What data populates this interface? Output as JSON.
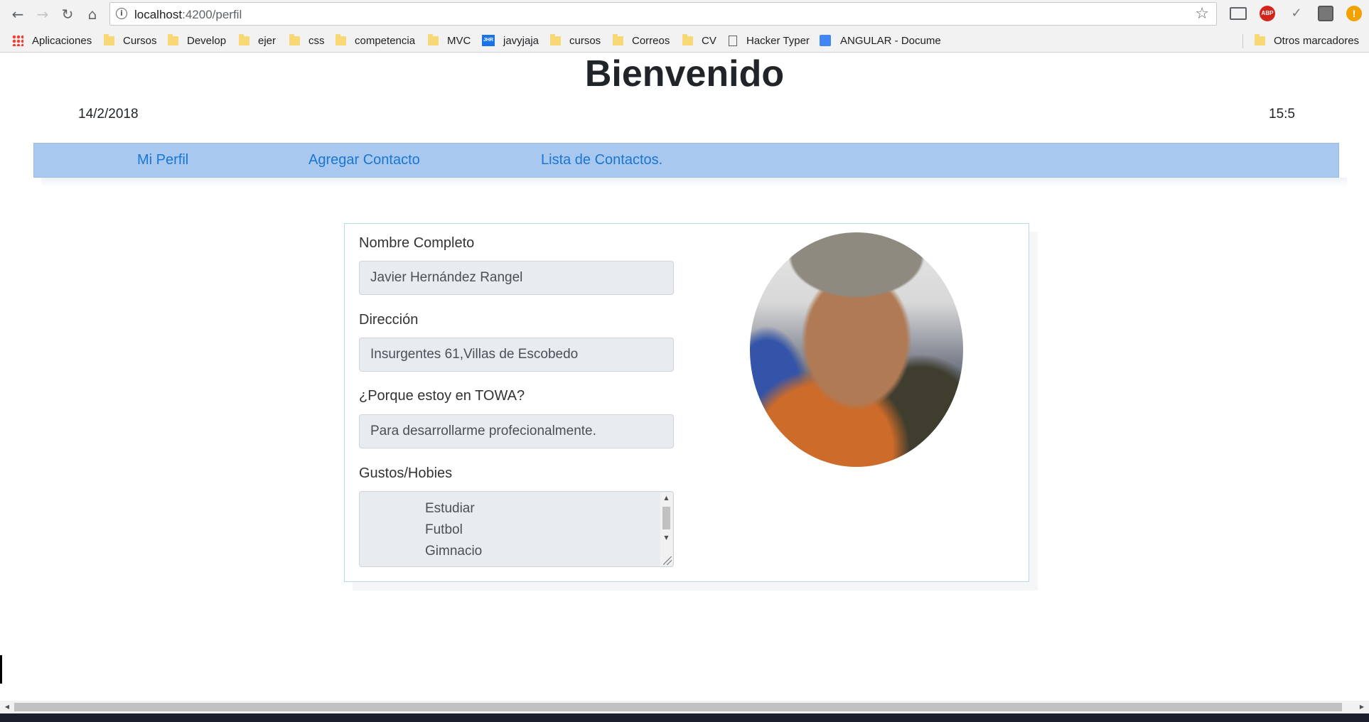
{
  "browser": {
    "url_host": "localhost",
    "url_path": ":4200/perfil",
    "bookmarks": [
      {
        "label": "Aplicaciones",
        "icon": "apps-icon"
      },
      {
        "label": "Cursos",
        "icon": "folder-icon"
      },
      {
        "label": "Develop",
        "icon": "folder-icon"
      },
      {
        "label": "ejer",
        "icon": "folder-icon"
      },
      {
        "label": "css",
        "icon": "folder-icon"
      },
      {
        "label": "competencia",
        "icon": "folder-icon"
      },
      {
        "label": "MVC",
        "icon": "folder-icon"
      },
      {
        "label": "javyjaja",
        "icon": "jhr-icon",
        "icon_text": "JHR"
      },
      {
        "label": "cursos",
        "icon": "folder-icon"
      },
      {
        "label": "Correos",
        "icon": "folder-icon"
      },
      {
        "label": "CV",
        "icon": "folder-icon"
      },
      {
        "label": "Hacker Typer",
        "icon": "page-icon"
      },
      {
        "label": "ANGULAR - Docume",
        "icon": "google-doc-icon"
      }
    ],
    "other_bookmarks": "Otros marcadores",
    "extensions": {
      "abp_label": "ABP",
      "warning_label": "!"
    }
  },
  "page": {
    "title": "Bienvenido",
    "date": "14/2/2018",
    "time": "15:5"
  },
  "nav": {
    "items": [
      "Mi Perfil",
      "Agregar Contacto",
      "Lista de Contactos."
    ],
    "accent_color": "#1976d2",
    "bar_color": "#a8c8f0"
  },
  "profile": {
    "name_label": "Nombre Completo",
    "name_value": "Javier Hernández Rangel",
    "address_label": "Dirección",
    "address_value": "Insurgentes 61,Villas de Escobedo",
    "why_label": "¿Porque estoy en TOWA?",
    "why_value": "Para desarrollarme profecionalmente.",
    "hobbies_label": "Gustos/Hobies",
    "hobbies": [
      "Estudiar",
      "Futbol",
      "Gimnacio"
    ]
  }
}
